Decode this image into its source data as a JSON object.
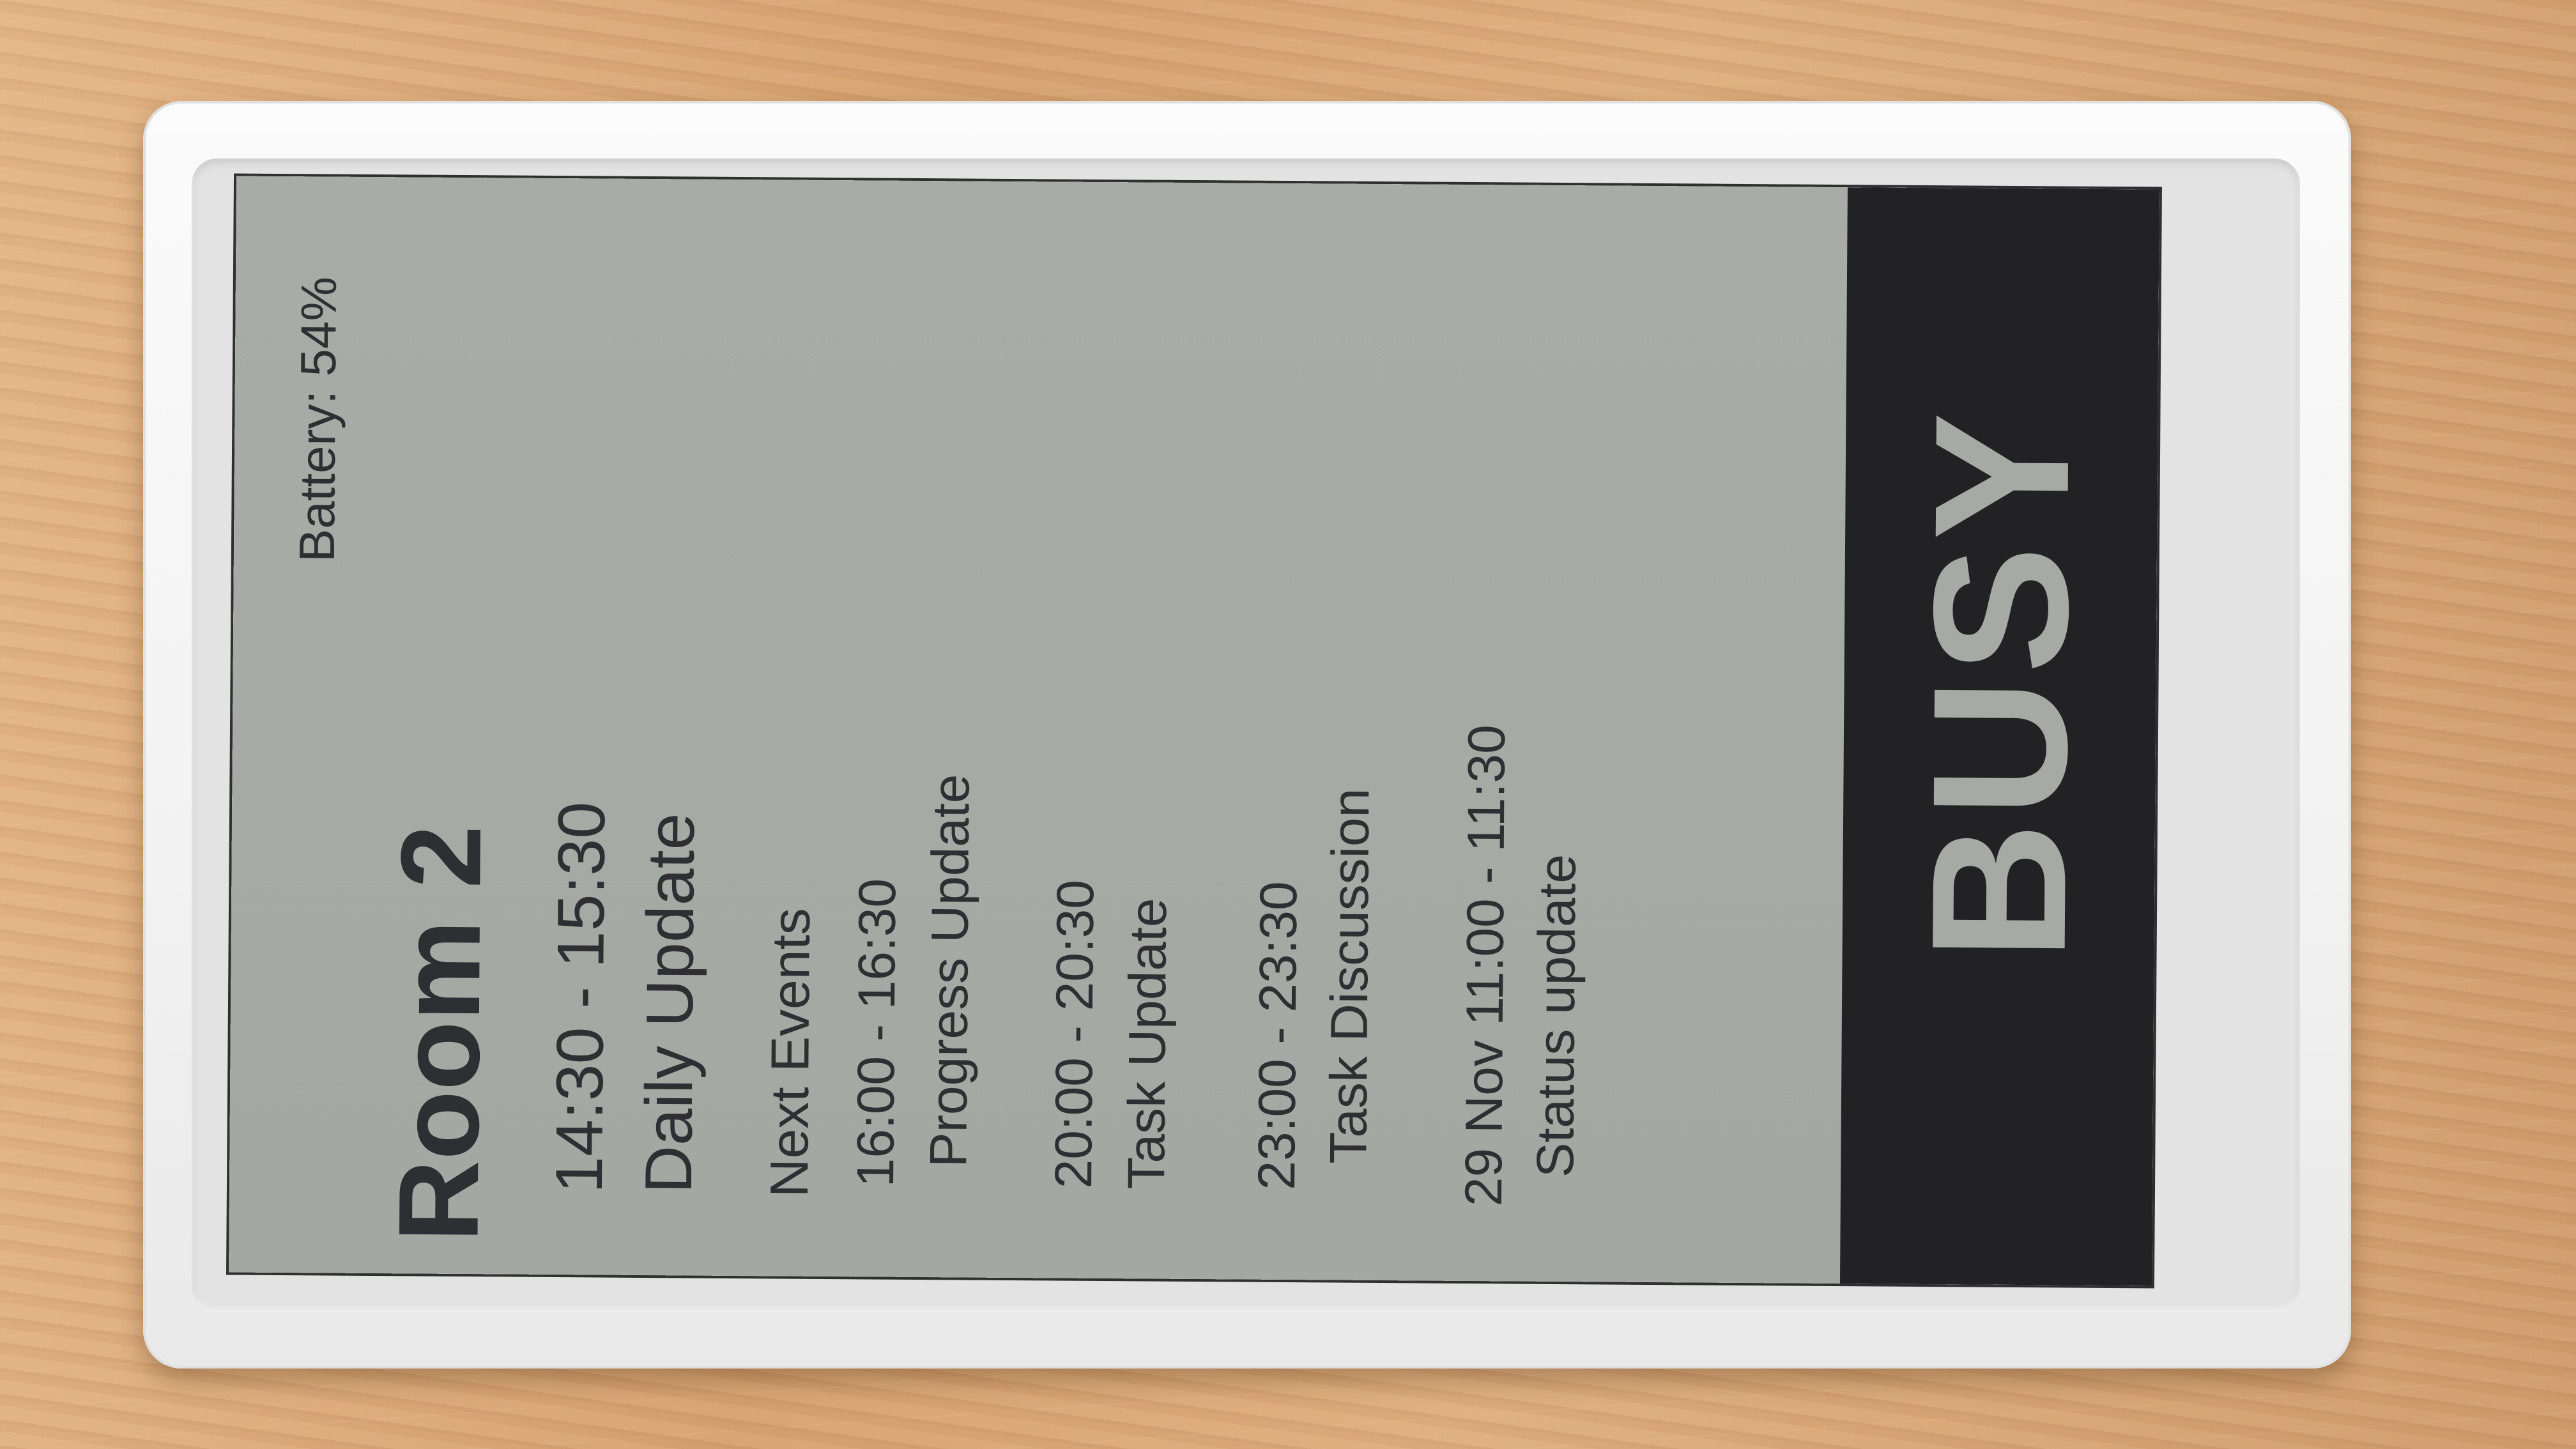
{
  "device": {
    "battery_label": "Battery: 54%",
    "room_name": "Room 2",
    "status": "BUSY",
    "status_panel_color": "#222124",
    "screen_color": "#a6aaa4"
  },
  "current_event": {
    "time": "14:30 - 15:30",
    "title": "Daily Update"
  },
  "next_events_label": "Next Events",
  "next_events": [
    {
      "time": "16:00 - 16:30",
      "title": "Progress Update"
    },
    {
      "time": "20:00 - 20:30",
      "title": "Task Update"
    },
    {
      "time": "23:00 - 23:30",
      "title": "Task Discussion"
    },
    {
      "time": "29 Nov 11:00 - 11:30",
      "title": "Status update"
    }
  ]
}
